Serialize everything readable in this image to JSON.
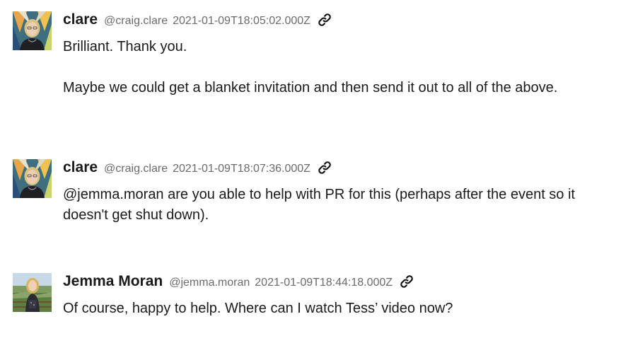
{
  "messages": [
    {
      "author": "clare",
      "handle": "@craig.clare",
      "timestamp": "2021-01-09T18:05:02.000Z",
      "link_icon": "link-icon",
      "paragraphs": [
        "Brilliant. Thank you.",
        "Maybe we could get a blanket invitation and then send it out to all of the above."
      ]
    },
    {
      "author": "clare",
      "handle": "@craig.clare",
      "timestamp": "2021-01-09T18:07:36.000Z",
      "link_icon": "link-icon",
      "paragraphs": [
        "@jemma.moran are you able to help with PR for this (perhaps after the event so it doesn't get shut down)."
      ]
    },
    {
      "author": "Jemma Moran",
      "handle": "@jemma.moran",
      "timestamp": "2021-01-09T18:44:18.000Z",
      "link_icon": "link-icon",
      "paragraphs": [
        "Of course, happy to help. Where can I watch Tess’ video now?"
      ]
    }
  ]
}
